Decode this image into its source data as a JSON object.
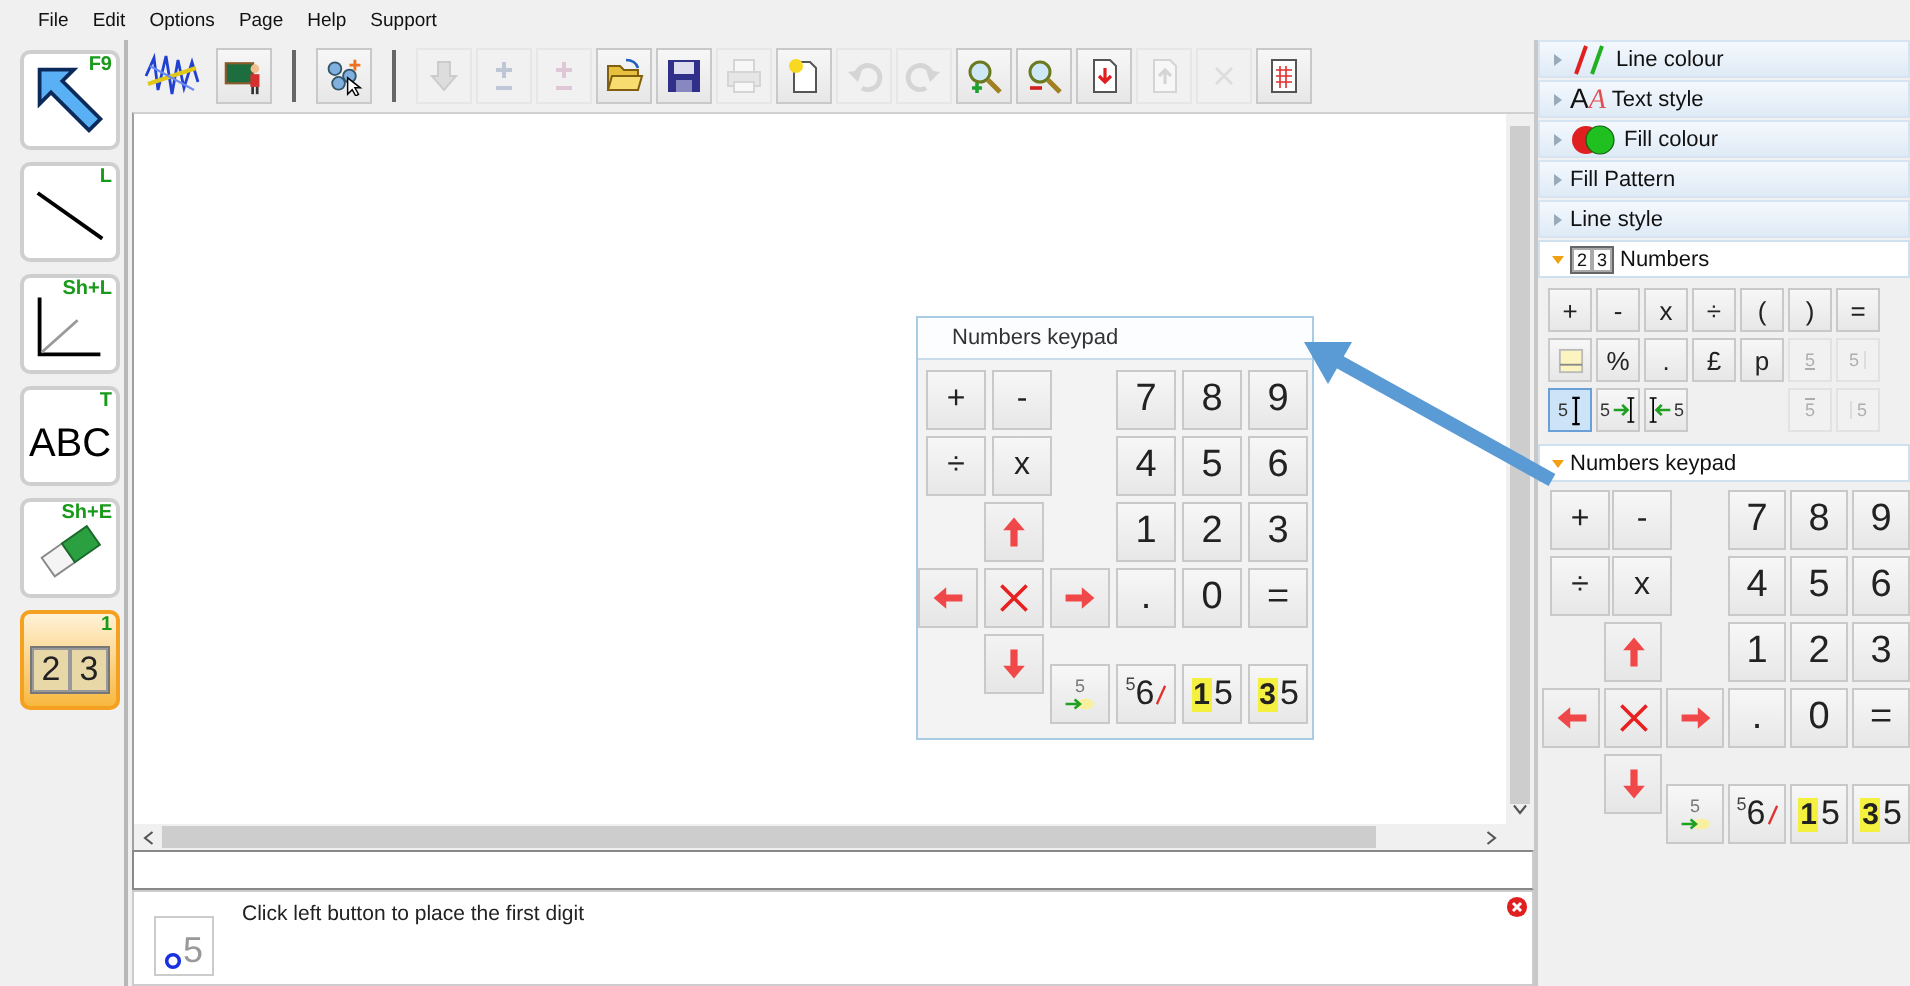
{
  "menu": [
    "File",
    "Edit",
    "Options",
    "Page",
    "Help",
    "Support"
  ],
  "tools": [
    {
      "kind": "arrow",
      "shortcut": "F9",
      "selected": false
    },
    {
      "kind": "line",
      "shortcut": "L",
      "selected": false
    },
    {
      "kind": "axes",
      "shortcut": "Sh+L",
      "selected": false
    },
    {
      "kind": "text",
      "shortcut": "T",
      "label": "ABC",
      "selected": false
    },
    {
      "kind": "eraser",
      "shortcut": "Sh+E",
      "selected": false
    },
    {
      "kind": "numbers",
      "shortcut": "1",
      "digits": [
        "2",
        "3"
      ],
      "selected": true
    }
  ],
  "toolbar": [
    {
      "kind": "logo",
      "disabled": false
    },
    {
      "kind": "teacher",
      "disabled": false
    },
    {
      "kind": "separator"
    },
    {
      "kind": "shapes",
      "disabled": false
    },
    {
      "kind": "separator"
    },
    {
      "kind": "hand",
      "disabled": true
    },
    {
      "kind": "plus-minus",
      "disabled": true
    },
    {
      "kind": "plus-minus-pink",
      "disabled": true
    },
    {
      "kind": "open",
      "disabled": false
    },
    {
      "kind": "save",
      "disabled": false
    },
    {
      "kind": "print",
      "disabled": true
    },
    {
      "kind": "new",
      "disabled": false
    },
    {
      "kind": "undo",
      "disabled": true
    },
    {
      "kind": "redo",
      "disabled": true
    },
    {
      "kind": "zoom-in",
      "disabled": false
    },
    {
      "kind": "zoom-out",
      "disabled": false
    },
    {
      "kind": "page-down",
      "disabled": false
    },
    {
      "kind": "page-up",
      "disabled": true
    },
    {
      "kind": "delete",
      "disabled": true
    },
    {
      "kind": "grid",
      "disabled": false
    }
  ],
  "canvas": {
    "keypad_window": {
      "title": "Numbers keypad",
      "keypad": {
        "ops": [
          "+",
          "-",
          "÷",
          "x"
        ],
        "digits": [
          "7",
          "8",
          "9",
          "4",
          "5",
          "6",
          "1",
          "2",
          "3",
          ".",
          "0",
          "="
        ],
        "specials": [
          {
            "kind": "move-digit",
            "text": "5"
          },
          {
            "kind": "strike",
            "sup": "5",
            "main": "6"
          },
          {
            "kind": "highlight",
            "hi": "1",
            "main": "5"
          },
          {
            "kind": "highlight",
            "hi": "3",
            "main": "5"
          }
        ]
      }
    }
  },
  "status": {
    "icon_digit": "5",
    "message": "Click left button to place the first digit"
  },
  "panel": {
    "sections": [
      {
        "kind": "line-colour",
        "label": "Line colour",
        "expanded": false
      },
      {
        "kind": "text-style",
        "label": "Text style",
        "icon_text": [
          "A",
          "A"
        ],
        "expanded": false
      },
      {
        "kind": "fill-colour",
        "label": "Fill colour",
        "expanded": false
      },
      {
        "kind": "plain",
        "label": "Fill Pattern",
        "expanded": false
      },
      {
        "kind": "plain",
        "label": "Line style",
        "expanded": false
      },
      {
        "kind": "numbers",
        "label": "Numbers",
        "digits": [
          "2",
          "3"
        ],
        "expanded": true,
        "buttons": [
          {
            "label": "+",
            "disabled": false
          },
          {
            "label": "-",
            "disabled": false
          },
          {
            "label": "x",
            "disabled": false
          },
          {
            "label": "÷",
            "disabled": false
          },
          {
            "label": "(",
            "disabled": false
          },
          {
            "label": ")",
            "disabled": false
          },
          {
            "label": "=",
            "disabled": false
          },
          {
            "kind": "box",
            "disabled": false
          },
          {
            "label": "%",
            "disabled": false
          },
          {
            "label": ".",
            "disabled": false
          },
          {
            "label": "£",
            "disabled": false
          },
          {
            "label": "p",
            "disabled": false
          },
          {
            "kind": "underline-digit",
            "digit": "5",
            "disabled": true
          },
          {
            "kind": "bar-digit",
            "digit": "5",
            "disabled": true
          },
          {
            "kind": "cursor-digit",
            "digit": "5",
            "disabled": false,
            "selected": true
          },
          {
            "kind": "move-right",
            "digit": "5",
            "disabled": false,
            "selected": false
          },
          {
            "kind": "move-left",
            "digit": "5",
            "disabled": false,
            "selected": false
          },
          {
            "kind": "gap"
          },
          {
            "kind": "gap"
          },
          {
            "kind": "overline-digit",
            "digit": "5",
            "disabled": true
          },
          {
            "kind": "bar-left",
            "digit": "5",
            "disabled": true
          }
        ]
      },
      {
        "kind": "keypad",
        "label": "Numbers keypad",
        "expanded": true,
        "keypad": {
          "ops": [
            "+",
            "-",
            "÷",
            "x"
          ],
          "digits": [
            "7",
            "8",
            "9",
            "4",
            "5",
            "6",
            "1",
            "2",
            "3",
            ".",
            "0",
            "="
          ],
          "specials": [
            {
              "kind": "move-digit",
              "text": "5"
            },
            {
              "kind": "strike",
              "sup": "5",
              "main": "6"
            },
            {
              "kind": "highlight",
              "hi": "1",
              "main": "5"
            },
            {
              "kind": "highlight",
              "hi": "3",
              "main": "5"
            }
          ]
        }
      }
    ]
  }
}
